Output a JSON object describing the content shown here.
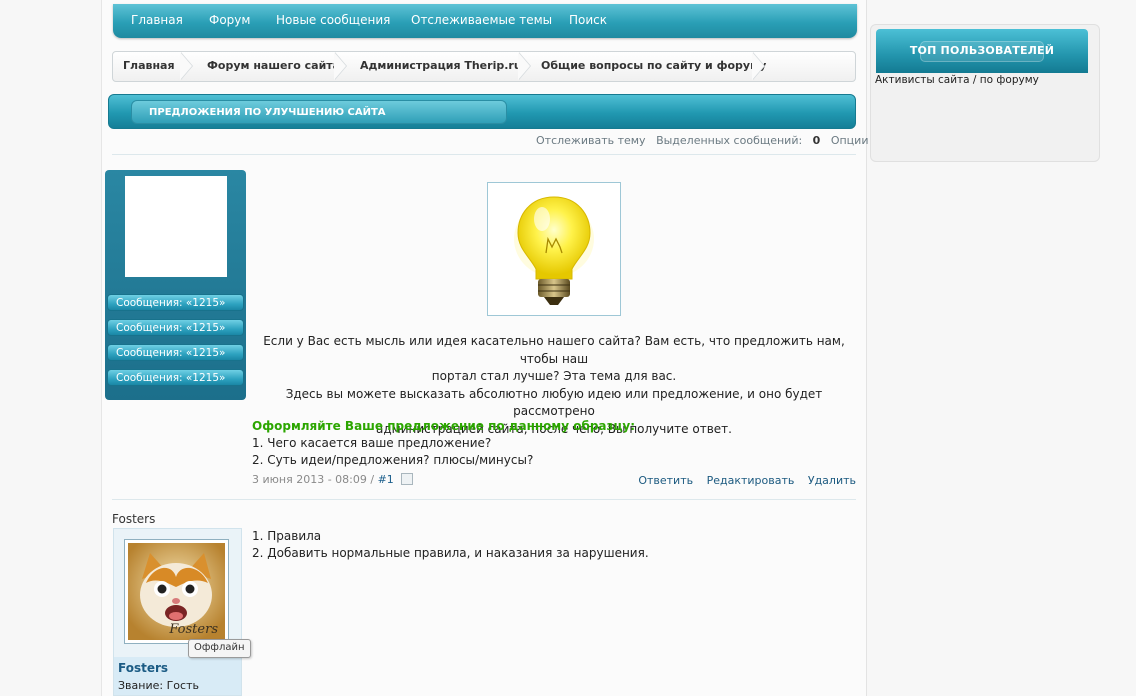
{
  "nav": {
    "items": [
      "Главная",
      "Форум",
      "Новые сообщения",
      "Отслеживаемые темы",
      "Поиск"
    ]
  },
  "breadcrumb": [
    "Главная",
    "Форум нашего сайта",
    "Администрация Therip.ru",
    "Общие вопросы по сайту и форуму"
  ],
  "topic": {
    "title": "ПРЕДЛОЖЕНИЯ ПО УЛУЧШЕНИЮ САЙТА",
    "tools": {
      "follow": "Отслеживать тему",
      "selected_label": "Выделенных сообщений:",
      "selected_count": "0",
      "options": "Опции темы"
    }
  },
  "post1": {
    "user_stats": [
      "Сообщения: «1215»",
      "Сообщения: «1215»",
      "Сообщения: «1215»",
      "Сообщения: «1215»"
    ],
    "text_lines": [
      "Если у Вас есть мысль или идея касательно нашего сайта? Вам есть, что предложить нам, чтобы наш",
      "портал стал лучше? Эта тема для вас.",
      "Здесь вы можете высказать абсолютно любую идею или предложение, и оно будет рассмотрено",
      "администрацией сайта, после чего, Вы получите ответ."
    ],
    "highlight": "Оформляйте Ваше предложение по данному образцу:",
    "list": [
      "1. Чего касается ваше предложение?",
      "2. Суть идеи/предложения? плюсы/минусы?"
    ],
    "date": "3 июня 2013 - 08:09 /",
    "post_number": "#1",
    "actions": [
      "Ответить",
      "Редактировать",
      "Удалить"
    ]
  },
  "post2": {
    "author_header": "Fosters",
    "avatar_caption": "Fosters",
    "username": "Fosters",
    "rank": "Звание: Гость",
    "status_tooltip": "Оффлайн",
    "lines": [
      "1. Правила",
      "2. Добавить нормальные правила, и наказания за нарушения."
    ]
  },
  "sidebar": {
    "top_users_title": "ТОП ПОЛЬЗОВАТЕЛЕЙ",
    "top_users_sub": "Активисты сайта / по форуму"
  },
  "colors": {
    "accent": "#2a9fb6",
    "highlight_green": "#2ca600",
    "link": "#1c5f8c"
  }
}
